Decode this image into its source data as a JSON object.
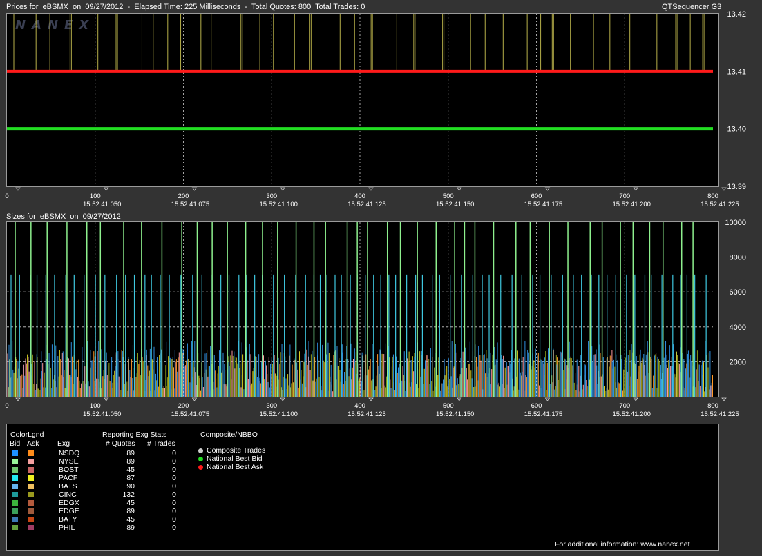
{
  "prices_header": {
    "title": "Prices for  eBSMX  on  09/27/2012  -  Elapsed Time: 225 Milliseconds  -  Total Quotes: 800  Total Trades: 0",
    "app": "QTSequencer G3"
  },
  "logo": "NANEX",
  "sizes_header": {
    "title": "Sizes for  eBSMX  on  09/27/2012"
  },
  "colors": {
    "background": "#333333",
    "plot_bg": "#000000",
    "ask_line": "#ff1a1a",
    "bid_line": "#22dd22",
    "quote_ticks": "#b7b04a",
    "size_green": "#8ef08e",
    "size_cyan": "#3fc8e0",
    "size_blue": "#2f8fe0",
    "size_orange": "#ff9a2a",
    "size_yellow": "#d8d020",
    "size_olive": "#8a9a1a",
    "size_pink": "#ff9aa0"
  },
  "chart_data": [
    {
      "type": "line",
      "xlim": [
        0,
        800
      ],
      "ylim": [
        13.39,
        13.42
      ],
      "y_ticks": [
        "13.42",
        "13.41",
        "13.40",
        "13.39"
      ],
      "x_ticks": [
        "0",
        "100",
        "200",
        "300",
        "400",
        "500",
        "600",
        "700",
        "800"
      ],
      "time_ticks": [
        "15:52:41:050",
        "15:52:41:075",
        "15:52:41:100",
        "15:52:41:125",
        "15:52:41:150",
        "15:52:41:175",
        "15:52:41:200",
        "15:52:41:225"
      ],
      "series": [
        {
          "name": "National Best Ask",
          "values": [
            13.41,
            13.41
          ]
        },
        {
          "name": "National Best Bid",
          "values": [
            13.4,
            13.4
          ]
        }
      ],
      "grid": true
    },
    {
      "type": "bar",
      "xlim": [
        0,
        800
      ],
      "ylim": [
        0,
        10000
      ],
      "y_ticks": [
        "10000",
        "8000",
        "6000",
        "4000",
        "2000"
      ],
      "x_ticks": [
        "0",
        "100",
        "200",
        "300",
        "400",
        "500",
        "600",
        "700",
        "800"
      ],
      "time_ticks": [
        "15:52:41:050",
        "15:52:41:075",
        "15:52:41:100",
        "15:52:41:125",
        "15:52:41:150",
        "15:52:41:175",
        "15:52:41:200",
        "15:52:41:225"
      ],
      "grid": true
    }
  ],
  "legend": {
    "title": "ColorLgnd",
    "bid_label": "Bid",
    "ask_label": "Ask",
    "exg_label": "Exg",
    "stats_title": "Reporting Exg Stats",
    "quotes_label": "# Quotes",
    "trades_label": "# Trades",
    "nbbo_title": "Composite/NBBO",
    "rows": [
      {
        "exg": "NSDQ",
        "quotes": "89",
        "trades": "0",
        "bid": "#1e90ff",
        "ask": "#ff8c1a"
      },
      {
        "exg": "NYSE",
        "quotes": "89",
        "trades": "0",
        "bid": "#98f598",
        "ask": "#f5a0a0"
      },
      {
        "exg": "BOST",
        "quotes": "45",
        "trades": "0",
        "bid": "#6ec86e",
        "ask": "#c86464"
      },
      {
        "exg": "PACF",
        "quotes": "87",
        "trades": "0",
        "bid": "#22e8f0",
        "ask": "#f0f020"
      },
      {
        "exg": "BATS",
        "quotes": "90",
        "trades": "0",
        "bid": "#64b4f0",
        "ask": "#f0c060"
      },
      {
        "exg": "CINC",
        "quotes": "132",
        "trades": "0",
        "bid": "#1e9a9a",
        "ask": "#9a9a1e"
      },
      {
        "exg": "EDGX",
        "quotes": "45",
        "trades": "0",
        "bid": "#3cb43c",
        "ask": "#b45a3c"
      },
      {
        "exg": "EDGE",
        "quotes": "89",
        "trades": "0",
        "bid": "#3ca05a",
        "ask": "#a05a3c"
      },
      {
        "exg": "BATY",
        "quotes": "45",
        "trades": "0",
        "bid": "#3c78b4",
        "ask": "#c84614"
      },
      {
        "exg": "PHIL",
        "quotes": "89",
        "trades": "0",
        "bid": "#64a03c",
        "ask": "#a03c64"
      }
    ],
    "nbbo": [
      {
        "label": "Composite Trades",
        "color": "#cccccc"
      },
      {
        "label": "National Best Bid",
        "color": "#22dd22"
      },
      {
        "label": "National Best Ask",
        "color": "#ff1a1a"
      }
    ],
    "footer": "For additional information: www.nanex.net"
  }
}
